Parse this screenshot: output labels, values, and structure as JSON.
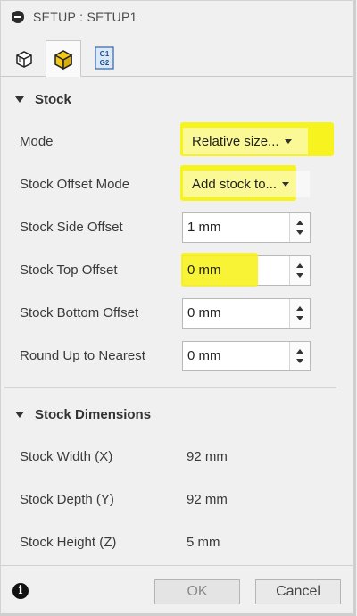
{
  "window": {
    "title": "SETUP : SETUP1"
  },
  "tabs": [
    {
      "icon": "setup-box-icon",
      "selected": false
    },
    {
      "icon": "stock-box-icon",
      "selected": true
    },
    {
      "icon": "g1-g2-program-icon",
      "selected": false,
      "text_top": "G1",
      "text_bottom": "G2"
    }
  ],
  "stock": {
    "header": "Stock",
    "mode": {
      "label": "Mode",
      "value": "Relative size..."
    },
    "offset_mode": {
      "label": "Stock Offset Mode",
      "value": "Add stock to..."
    },
    "side_offset": {
      "label": "Stock Side Offset",
      "value": "1 mm"
    },
    "top_offset": {
      "label": "Stock Top Offset",
      "value": "0 mm"
    },
    "bottom_offset": {
      "label": "Stock Bottom Offset",
      "value": "0 mm"
    },
    "round_up": {
      "label": "Round Up to Nearest",
      "value": "0 mm"
    }
  },
  "dimensions": {
    "header": "Stock Dimensions",
    "width": {
      "label": "Stock Width (X)",
      "value": "92 mm"
    },
    "depth": {
      "label": "Stock Depth (Y)",
      "value": "92 mm"
    },
    "height": {
      "label": "Stock Height (Z)",
      "value": "5 mm"
    }
  },
  "footer": {
    "ok": "OK",
    "cancel": "Cancel"
  },
  "colors": {
    "highlight": "#f7f31f",
    "stock_icon": "#f2c81c"
  }
}
